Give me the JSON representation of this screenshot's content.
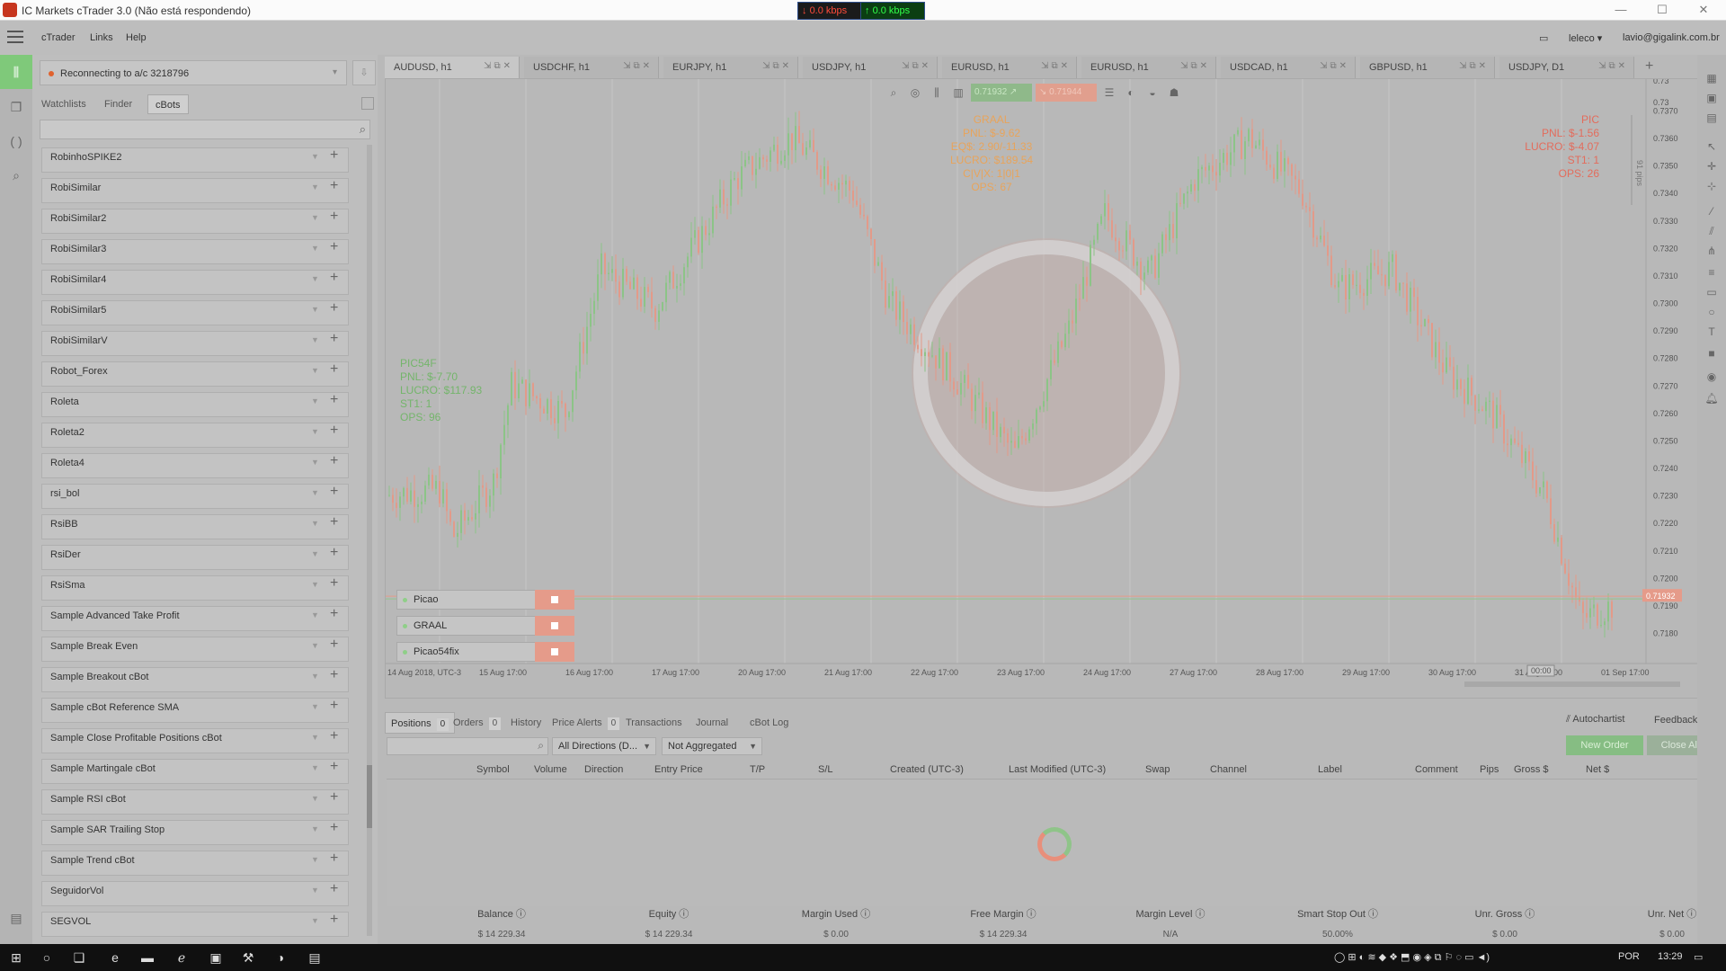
{
  "window": {
    "title": "IC Markets cTrader 3.0 (Não está respondendo)",
    "download_speed": "0.0 kbps",
    "upload_speed": "0.0 kbps"
  },
  "menubar": {
    "items": [
      "cTrader",
      "Links",
      "Help"
    ],
    "user": "leleco",
    "email": "lavio@gigalink.com.br"
  },
  "left_panel": {
    "account_status": "Reconnecting to a/c 3218796",
    "tabs": [
      "Watchlists",
      "Finder",
      "cBots"
    ],
    "active_tab": "cBots",
    "bots": [
      "RobinhoSPIKE2",
      "RobiSimilar",
      "RobiSimilar2",
      "RobiSimilar3",
      "RobiSimilar4",
      "RobiSimilar5",
      "RobiSimilarV",
      "Robot_Forex",
      "Roleta",
      "Roleta2",
      "Roleta4",
      "rsi_bol",
      "RsiBB",
      "RsiDer",
      "RsiSma",
      "Sample Advanced Take Profit",
      "Sample Break Even",
      "Sample Breakout cBot",
      "Sample cBot Reference SMA",
      "Sample Close Profitable Positions cBot",
      "Sample Martingale cBot",
      "Sample RSI cBot",
      "Sample SAR Trailing Stop",
      "Sample Trend cBot",
      "SeguidorVol",
      "SEGVOL"
    ]
  },
  "chart_tabs": [
    "AUDUSD, h1",
    "USDCHF, h1",
    "EURJPY, h1",
    "USDJPY, h1",
    "EURUSD, h1",
    "EURUSD, h1",
    "USDCAD, h1",
    "GBPUSD, h1",
    "USDJPY, D1"
  ],
  "chart": {
    "sell_price": "0.71932",
    "buy_price": "0.71944",
    "current_price": "0.71932",
    "price_labels": [
      "0.7370",
      "0.7360",
      "0.7350",
      "0.7340",
      "0.7330",
      "0.7320",
      "0.7310",
      "0.7300",
      "0.7290",
      "0.7280",
      "0.7270",
      "0.7260",
      "0.7250",
      "0.7240",
      "0.7230",
      "0.7220",
      "0.7210",
      "0.7200",
      "0.7190",
      "0.7180"
    ],
    "price_top_partial": [
      "0.73",
      "0.73"
    ],
    "time_labels": [
      "14 Aug 2018, UTC-3",
      "15 Aug 17:00",
      "16 Aug 17:00",
      "17 Aug 17:00",
      "20 Aug 17:00",
      "21 Aug 17:00",
      "22 Aug 17:00",
      "23 Aug 17:00",
      "24 Aug 17:00",
      "27 Aug 17:00",
      "28 Aug 17:00",
      "29 Aug 17:00",
      "30 Aug 17:00",
      "31 Aug 17:00",
      "01 Sep 17:00"
    ],
    "countdown": "00:00",
    "pips_label": "91 pips",
    "graal": [
      "GRAAL",
      "PNL: $-9.62",
      "EQ$: 2.90/-11.33",
      "LUCRO: $189.54",
      "C|V|X: 1|0|1",
      "OPS: 67"
    ],
    "pic": [
      "PIC",
      "PNL: $-1.56",
      "LUCRO: $-4.07",
      "ST1: 1",
      "OPS: 26"
    ],
    "pic54": [
      "PIC54F",
      "PNL: $-7.70",
      "LUCRO: $117.93",
      "ST1: 1",
      "OPS: 96"
    ],
    "running_bots": [
      "Picao",
      "GRAAL",
      "Picao54fix"
    ]
  },
  "bottom": {
    "tabs": [
      {
        "label": "Positions",
        "count": "0"
      },
      {
        "label": "Orders",
        "count": "0"
      },
      {
        "label": "History",
        "count": ""
      },
      {
        "label": "Price Alerts",
        "count": "0"
      },
      {
        "label": "Transactions",
        "count": ""
      },
      {
        "label": "Journal",
        "count": ""
      },
      {
        "label": "cBot Log",
        "count": ""
      }
    ],
    "autochartist": "Autochartist",
    "feedback": "Feedback",
    "direction_filter": "All Directions (D...",
    "aggregation": "Not Aggregated",
    "new_order": "New Order",
    "close_all": "Close All",
    "columns": [
      "Symbol",
      "Volume",
      "Direction",
      "Entry Price",
      "T/P",
      "S/L",
      "Created (UTC-3)",
      "Last Modified (UTC-3)",
      "Swap",
      "Channel",
      "Label",
      "Comment",
      "Pips",
      "Gross $",
      "Net $"
    ],
    "summary": [
      {
        "label": "Balance",
        "value": "$ 14 229.34"
      },
      {
        "label": "Equity",
        "value": "$ 14 229.34"
      },
      {
        "label": "Margin Used",
        "value": "$ 0.00"
      },
      {
        "label": "Free Margin",
        "value": "$ 14 229.34"
      },
      {
        "label": "Margin Level",
        "value": "N/A"
      },
      {
        "label": "Smart Stop Out",
        "value": "50.00%"
      },
      {
        "label": "Unr. Gross",
        "value": "$ 0.00"
      },
      {
        "label": "Unr. Net",
        "value": "$ 0.00"
      }
    ]
  },
  "taskbar": {
    "language": "POR",
    "time": "13:29"
  },
  "colors": {
    "buy_accent": "#e59b8a",
    "sell_accent": "#86bd83",
    "graal_text": "#e8a45b",
    "pic_text": "#e36c5c",
    "pic54_text": "#74b56b"
  }
}
